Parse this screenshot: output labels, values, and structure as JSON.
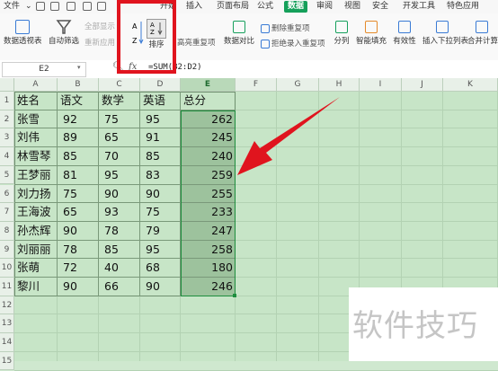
{
  "menu": {
    "file": "文件",
    "tabs": [
      "开始",
      "插入",
      "页面布局",
      "公式",
      "数据",
      "审阅",
      "视图",
      "安全",
      "开发工具",
      "特色应用"
    ],
    "active_tab": "数据"
  },
  "ribbon": {
    "pivot": "数据透视表",
    "autofilter": "自动筛选",
    "show_all": "全部显示",
    "reapply": "重新应用",
    "sort": "排序",
    "highlight_dup": "高亮重复项",
    "compare": "数据对比",
    "remove_dup": "删除重复项",
    "reject_dup": "拒绝录入重复项",
    "split": "分列",
    "smart_fill": "智能填充",
    "validity": "有效性",
    "insert_dropdown": "插入下拉列表",
    "merge_calc": "合并计算"
  },
  "formula_bar": {
    "cell_ref": "E2",
    "zoom_icon": "magnifier-icon",
    "fx": "fx",
    "formula": "=SUM(B2:D2)"
  },
  "sheet": {
    "columns": [
      "A",
      "B",
      "C",
      "D",
      "E",
      "F",
      "G",
      "H",
      "I",
      "J",
      "K"
    ],
    "selected_column": "E",
    "row_numbers": [
      "1",
      "2",
      "3",
      "4",
      "5",
      "6",
      "7",
      "8",
      "9",
      "10",
      "11",
      "12",
      "13",
      "14",
      "15"
    ],
    "header": [
      "姓名",
      "语文",
      "数学",
      "英语",
      "总分"
    ],
    "rows": [
      [
        "张雪",
        "92",
        "75",
        "95",
        "262"
      ],
      [
        "刘伟",
        "89",
        "65",
        "91",
        "245"
      ],
      [
        "林雪琴",
        "85",
        "70",
        "85",
        "240"
      ],
      [
        "王梦丽",
        "81",
        "95",
        "83",
        "259"
      ],
      [
        "刘力扬",
        "75",
        "90",
        "90",
        "255"
      ],
      [
        "王海波",
        "65",
        "93",
        "75",
        "233"
      ],
      [
        "孙杰辉",
        "90",
        "78",
        "79",
        "247"
      ],
      [
        "刘丽丽",
        "78",
        "85",
        "95",
        "258"
      ],
      [
        "张萌",
        "72",
        "40",
        "68",
        "180"
      ],
      [
        "黎川",
        "90",
        "66",
        "90",
        "246"
      ]
    ]
  },
  "annotation": {
    "arrow_color": "#e0141e",
    "box_color": "#e0141e"
  },
  "watermark": "软件技巧"
}
